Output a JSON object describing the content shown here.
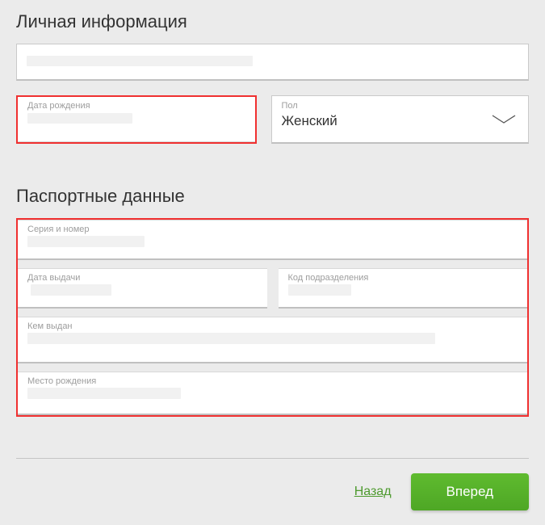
{
  "sections": {
    "personal": {
      "title": "Личная информация"
    },
    "passport": {
      "title": "Паспортные данные"
    }
  },
  "fields": {
    "dob": {
      "label": "Дата рождения"
    },
    "gender": {
      "label": "Пол",
      "value": "Женский"
    },
    "series": {
      "label": "Серия и номер"
    },
    "issue_date": {
      "label": "Дата выдачи"
    },
    "dept_code": {
      "label": "Код подразделения"
    },
    "issued_by": {
      "label": "Кем выдан"
    },
    "birth_place": {
      "label": "Место рождения"
    }
  },
  "buttons": {
    "back": "Назад",
    "forward": "Вперед"
  }
}
